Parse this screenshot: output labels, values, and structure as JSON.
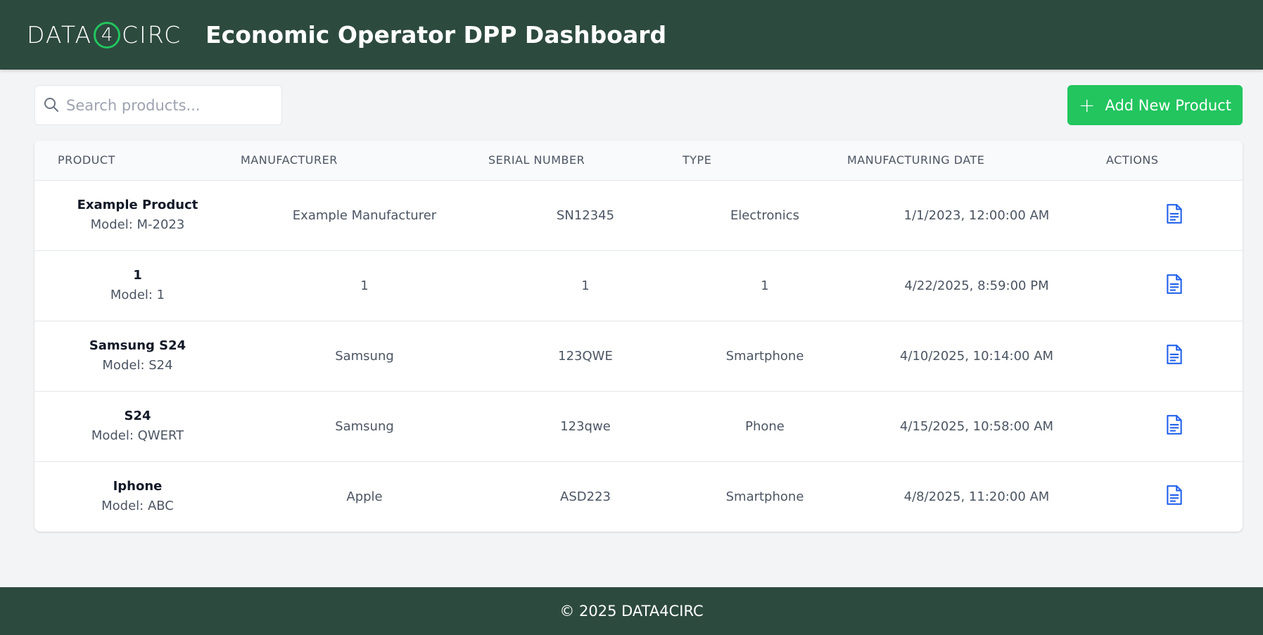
{
  "header": {
    "logo_left": "DATA",
    "logo_mid": "4",
    "logo_right": "CIRC",
    "title": "Economic Operator DPP Dashboard"
  },
  "toolbar": {
    "search_placeholder": "Search products...",
    "search_icon": "search-icon",
    "add_button_label": "Add New Product",
    "add_button_icon": "plus-icon"
  },
  "table": {
    "columns": [
      "PRODUCT",
      "MANUFACTURER",
      "SERIAL NUMBER",
      "TYPE",
      "MANUFACTURING DATE",
      "ACTIONS"
    ],
    "rows": [
      {
        "name": "Example Product",
        "model": "Model: M-2023",
        "manufacturer": "Example Manufacturer",
        "serial": "SN12345",
        "type": "Electronics",
        "date": "1/1/2023, 12:00:00 AM",
        "action_icon": "document-icon"
      },
      {
        "name": "1",
        "model": "Model: 1",
        "manufacturer": "1",
        "serial": "1",
        "type": "1",
        "date": "4/22/2025, 8:59:00 PM",
        "action_icon": "document-icon"
      },
      {
        "name": "Samsung S24",
        "model": "Model: S24",
        "manufacturer": "Samsung",
        "serial": "123QWE",
        "type": "Smartphone",
        "date": "4/10/2025, 10:14:00 AM",
        "action_icon": "document-icon"
      },
      {
        "name": "S24",
        "model": "Model: QWERT",
        "manufacturer": "Samsung",
        "serial": "123qwe",
        "type": "Phone",
        "date": "4/15/2025, 10:58:00 AM",
        "action_icon": "document-icon"
      },
      {
        "name": "Iphone",
        "model": "Model: ABC",
        "manufacturer": "Apple",
        "serial": "ASD223",
        "type": "Smartphone",
        "date": "4/8/2025, 11:20:00 AM",
        "action_icon": "document-icon"
      }
    ]
  },
  "footer": {
    "text": "© 2025 DATA4CIRC"
  },
  "colors": {
    "header_bg": "#2d4a3f",
    "accent_green": "#22c55e",
    "action_blue": "#2563eb",
    "page_bg": "#f3f4f6"
  }
}
